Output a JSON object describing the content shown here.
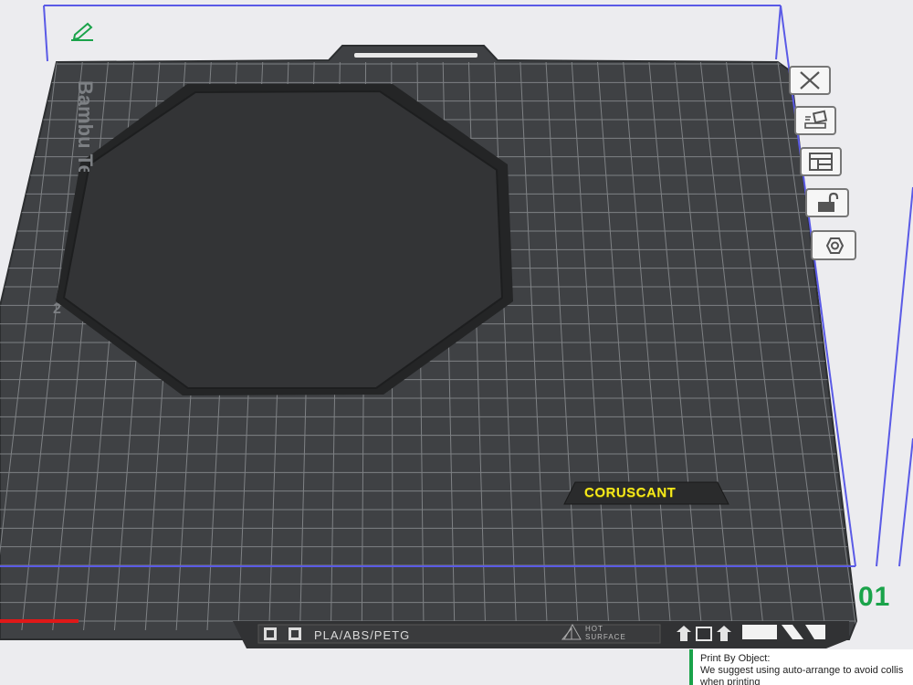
{
  "plate": {
    "brand_label": "Bambu Te",
    "side_number": "2",
    "plate_number": "01",
    "strip_label": "PLA/ABS/PETG",
    "hot_surface_line1": "HOT",
    "hot_surface_line2": "SURFACE"
  },
  "model": {
    "label_text": "CORUSCANT"
  },
  "toolbar": {
    "buttons": [
      {
        "name": "close-plate-button",
        "icon": "close-icon"
      },
      {
        "name": "auto-orient-button",
        "icon": "orient-icon"
      },
      {
        "name": "arrange-button",
        "icon": "arrange-icon"
      },
      {
        "name": "lock-plate-button",
        "icon": "lock-icon"
      },
      {
        "name": "plate-settings-button",
        "icon": "hex-nut-icon"
      }
    ]
  },
  "notice": {
    "title": "Print By Object:",
    "message": "We suggest using auto-arrange to avoid collis",
    "message2": "when printing"
  },
  "colors": {
    "plate": "#3f4144",
    "grid": "#8a8d90",
    "bounding_box": "#5a5ae6",
    "accent_green": "#1aa34a",
    "label_yellow": "#f6ea1c"
  }
}
